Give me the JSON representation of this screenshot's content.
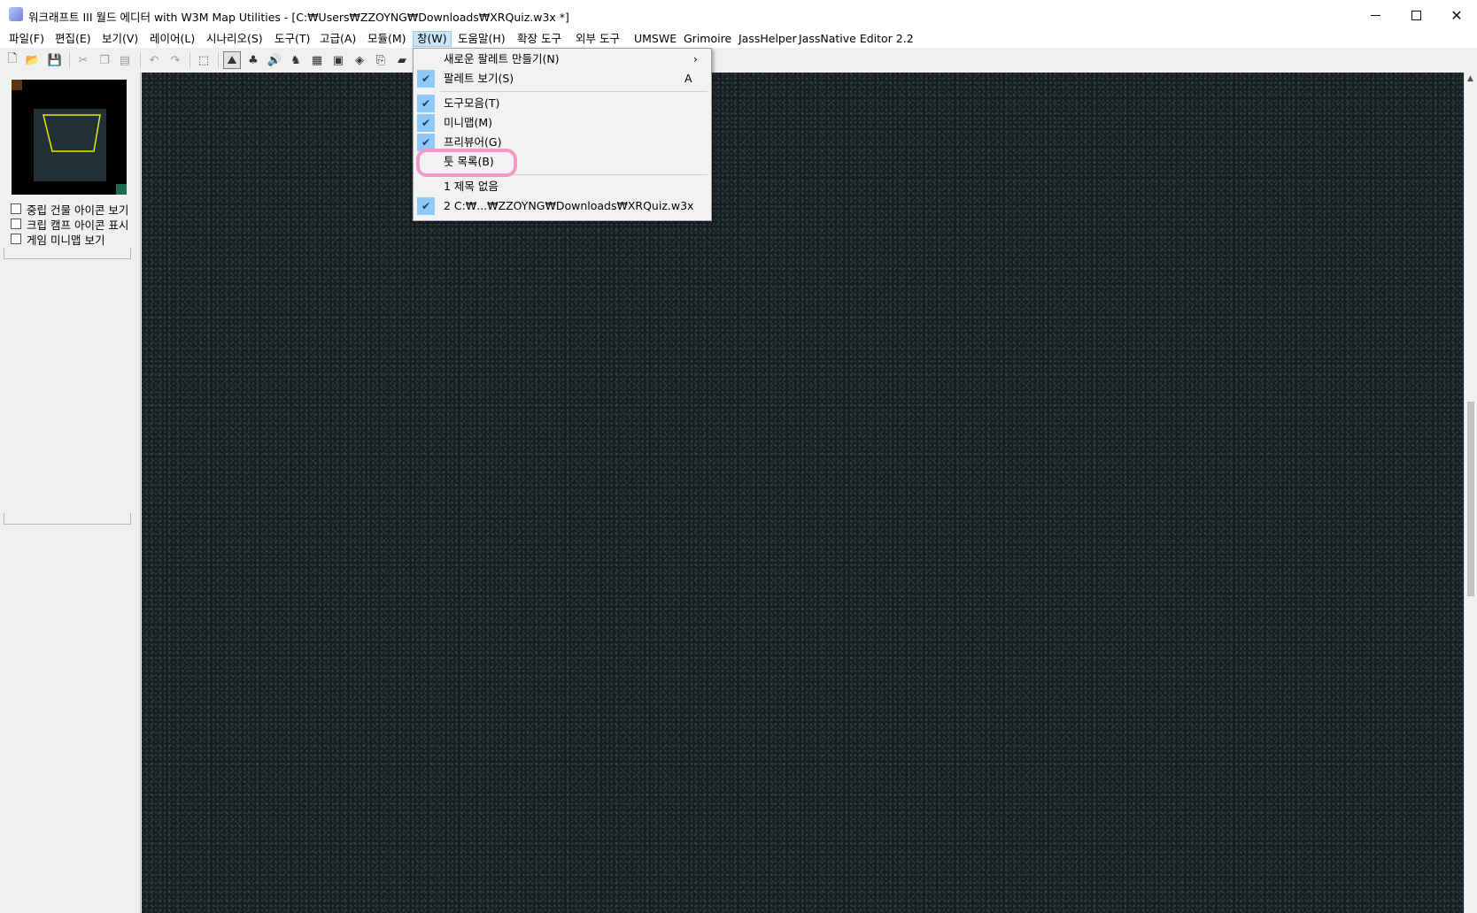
{
  "window": {
    "title": "워크래프트 III 월드 에디터 with W3M Map Utilities - [C:₩Users₩ZZOYNG₩Downloads₩XRQuiz.w3x *]"
  },
  "menubar": {
    "items": [
      {
        "label": "파일(F)"
      },
      {
        "label": "편집(E)"
      },
      {
        "label": "보기(V)"
      },
      {
        "label": "레이어(L)"
      },
      {
        "label": "시나리오(S)"
      },
      {
        "label": "도구(T)"
      },
      {
        "label": "고급(A)"
      },
      {
        "label": "모듈(M)"
      },
      {
        "label": "창(W)",
        "active": true
      },
      {
        "label": "도움말(H)"
      },
      {
        "label": "확장 도구"
      },
      {
        "label": "외부 도구"
      },
      {
        "label": "UMSWE"
      },
      {
        "label": "Grimoire"
      },
      {
        "label": "JassHelper"
      },
      {
        "label": "JassNative Editor 2.2"
      }
    ]
  },
  "toolbar": {
    "icons": [
      "new-file-icon",
      "open-folder-icon",
      "save-icon",
      "cut-icon",
      "copy-icon",
      "paste-icon",
      "undo-icon",
      "redo-icon",
      "select-icon",
      "terrain-palette-icon",
      "doodad-palette-icon",
      "sound-icon",
      "unit-palette-icon",
      "region-icon",
      "camera-icon",
      "object-editor-icon",
      "import-manager-icon",
      "trigger-editor-icon"
    ]
  },
  "leftpanel": {
    "checkboxes": [
      {
        "label": "중립 건물 아이콘 보기",
        "checked": false
      },
      {
        "label": "크립 캠프 아이콘 표시",
        "checked": false
      },
      {
        "label": "게임 미니맵 보기",
        "checked": false
      }
    ]
  },
  "window_menu": {
    "items": [
      {
        "label": "새로운 팔레트 만들기(N)",
        "checked": false,
        "submenu_arrow": "›"
      },
      {
        "label": "팔레트 보기(S)",
        "checked": true,
        "shortcut": "A"
      },
      {
        "label": "도구모음(T)",
        "checked": true
      },
      {
        "label": "미니맵(M)",
        "checked": true
      },
      {
        "label": "프리뷰어(G)",
        "checked": true
      },
      {
        "label": "툿 목록(B)",
        "checked": false,
        "highlighted": true
      },
      {
        "label": "1 제목 없음",
        "checked": false
      },
      {
        "label": "2 C:₩...₩ZZOYNG₩Downloads₩XRQuiz.w3x",
        "checked": true
      }
    ]
  },
  "colors": {
    "map_bg": "#161e20",
    "menu_active": "#cce4f7",
    "check_bg": "#90c8f6",
    "highlight": "#f29ac7",
    "minimap_viewport": "#e8e800"
  }
}
